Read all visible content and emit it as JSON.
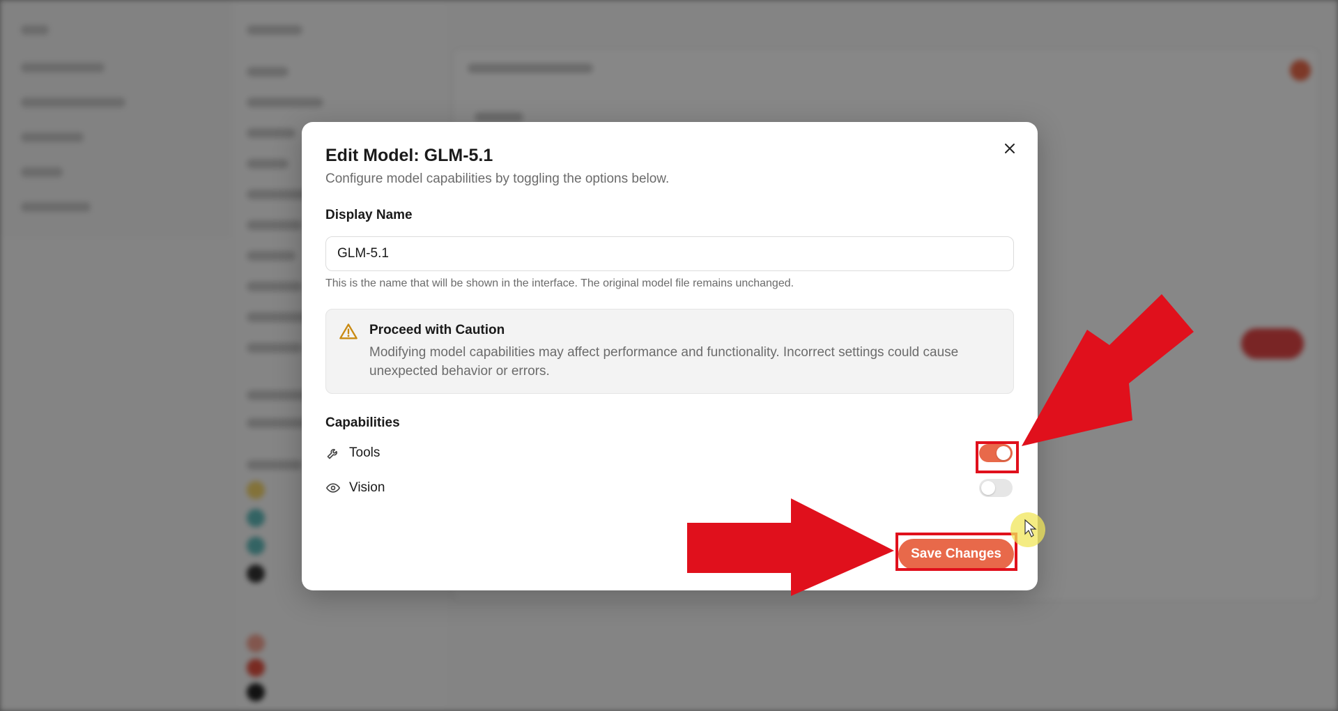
{
  "modal": {
    "title": "Edit Model: GLM-5.1",
    "subtitle": "Configure model capabilities by toggling the options below.",
    "display_name_label": "Display Name",
    "display_name_value": "GLM-5.1",
    "display_name_helper": "This is the name that will be shown in the interface. The original model file remains unchanged.",
    "caution": {
      "title": "Proceed with Caution",
      "body": "Modifying model capabilities may affect performance and functionality. Incorrect settings could cause unexpected behavior or errors."
    },
    "capabilities_label": "Capabilities",
    "capabilities": [
      {
        "label": "Tools",
        "icon": "wrench-icon",
        "enabled": true
      },
      {
        "label": "Vision",
        "icon": "eye-icon",
        "enabled": false
      }
    ],
    "save_label": "Save Changes"
  },
  "colors": {
    "accent": "#e8694a",
    "toggle_off": "#e6e6e6",
    "warning": "#c98a12",
    "annotation_red": "#e0101c"
  }
}
